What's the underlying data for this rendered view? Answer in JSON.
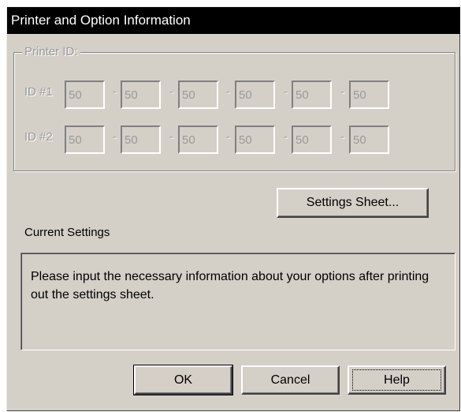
{
  "dialog": {
    "title": "Printer and Option Information"
  },
  "printer_id": {
    "group_label": "Printer ID:",
    "rows": [
      {
        "label": "ID #1",
        "values": [
          "50",
          "50",
          "50",
          "50",
          "50",
          "50"
        ]
      },
      {
        "label": "ID #2",
        "values": [
          "50",
          "50",
          "50",
          "50",
          "50",
          "50"
        ]
      }
    ],
    "separator": "-"
  },
  "settings_sheet_button": "Settings Sheet...",
  "current_settings": {
    "label": "Current Settings",
    "text": "Please input the necessary information about your options after printing out the settings sheet."
  },
  "buttons": {
    "ok": "OK",
    "cancel": "Cancel",
    "help": "Help"
  }
}
